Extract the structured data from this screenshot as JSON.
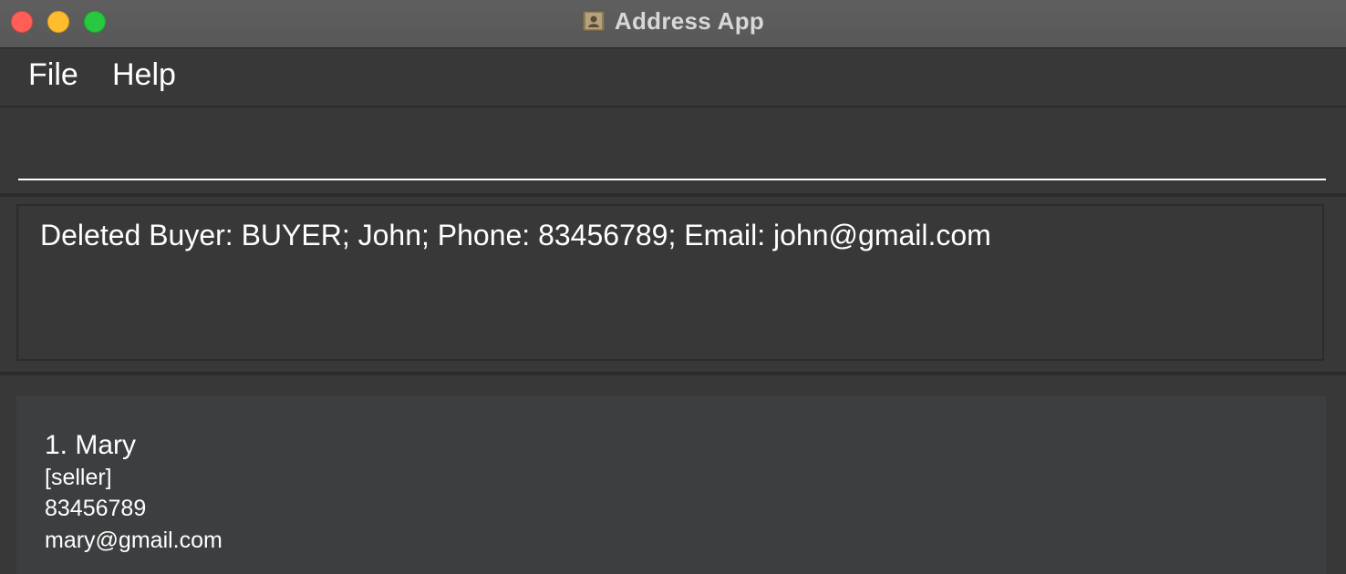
{
  "window": {
    "title": "Address App",
    "icon": "contacts-app-icon"
  },
  "menu": {
    "file_label": "File",
    "help_label": "Help"
  },
  "command": {
    "value": "",
    "placeholder": ""
  },
  "result": {
    "message": "Deleted Buyer: BUYER; John; Phone: 83456789; Email: john@gmail.com"
  },
  "persons": [
    {
      "name": "1. Mary",
      "role": "[seller]",
      "phone": "83456789",
      "email": "mary@gmail.com"
    }
  ],
  "colors": {
    "close": "#ff5f57",
    "minimize": "#febc2e",
    "maximize": "#28c840",
    "background": "#383838",
    "card": "#3c3e3f"
  }
}
